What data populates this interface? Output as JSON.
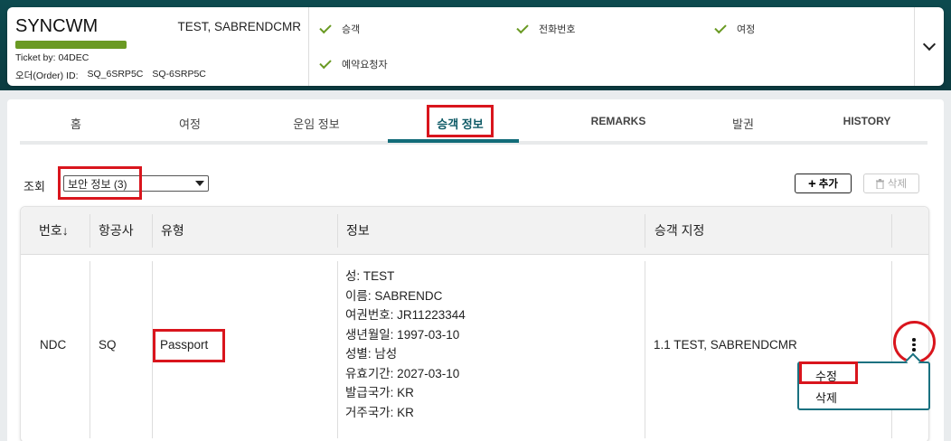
{
  "booking": {
    "code": "SYNCWM",
    "passenger": "TEST, SABRENDCMR",
    "ticket": "Ticket by: 04DEC",
    "order_label": "오더(Order) ID:",
    "order_id_1": "SQ_6SRP5C",
    "order_id_2": "SQ-6SRP5C",
    "status_color": "#6a9a23",
    "checks": [
      "승객",
      "전화번호",
      "여정",
      "예약요청자"
    ]
  },
  "tabs": [
    "홈",
    "여정",
    "운임 정보",
    "승객 정보",
    "REMARKS",
    "발권",
    "HISTORY"
  ],
  "active_tab": "승객 정보",
  "lookup": {
    "label": "조회",
    "selected": "보안 정보 (3)"
  },
  "buttons": {
    "add": "추가",
    "delete": "삭제"
  },
  "table": {
    "columns": [
      "번호",
      "항공사",
      "유형",
      "정보",
      "승객 지정"
    ],
    "sort_indicator": "↓",
    "row": {
      "number": "NDC",
      "airline": "SQ",
      "type": "Passport",
      "info": [
        "성: TEST",
        "이름: SABRENDC",
        "여권번호: JR11223344",
        "생년월일: 1997-03-10",
        "성별: 남성",
        "유효기간: 2027-03-10",
        "발급국가: KR",
        "거주국가: KR"
      ],
      "passenger": "1.1 TEST, SABRENDCMR"
    }
  },
  "context_menu": [
    "수정",
    "삭제"
  ],
  "colors": {
    "accent": "#126c79",
    "highlight": "#d9151d",
    "check": "#6a9a23"
  }
}
